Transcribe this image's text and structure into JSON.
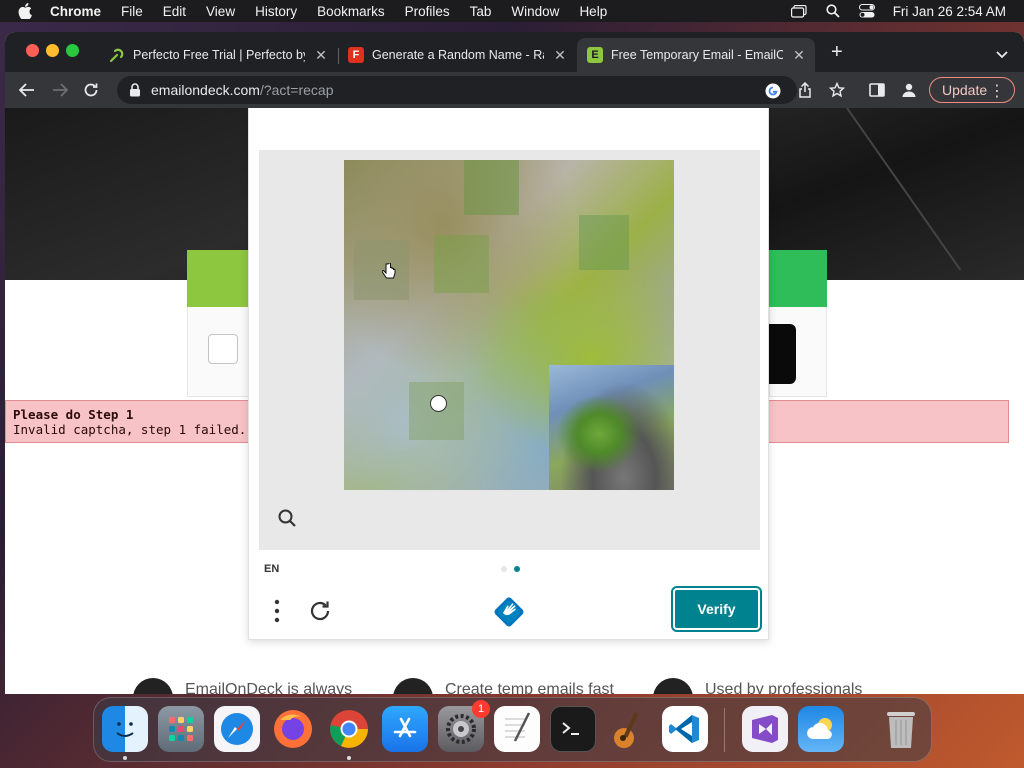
{
  "menubar": {
    "items": [
      "Chrome",
      "File",
      "Edit",
      "View",
      "History",
      "Bookmarks",
      "Profiles",
      "Tab",
      "Window",
      "Help"
    ],
    "datetime": "Fri Jan 26  2:54 AM"
  },
  "browser": {
    "tabs": [
      {
        "title": "Perfecto Free Trial | Perfecto by",
        "favicon": "perfecto-icon",
        "color": "#8dc63f"
      },
      {
        "title": "Generate a Random Name - Ra",
        "favicon": "F",
        "color": "#e0301e"
      },
      {
        "title": "Free Temporary Email - EmailO",
        "favicon": "E",
        "color": "#8dc63f"
      }
    ],
    "url_host": "emailondeck.com",
    "url_path": "/?act=recap",
    "update_label": "Update"
  },
  "page": {
    "error_title": "Please do Step 1",
    "error_message": "Invalid captcha, step 1 failed.",
    "features": [
      {
        "text": "EmailOnDeck is always",
        "icon": "free-badge-icon"
      },
      {
        "text": "Create temp emails fast",
        "icon": "send-icon"
      },
      {
        "text": "Used by professionals",
        "icon": "globe-icon"
      }
    ]
  },
  "captcha": {
    "language": "EN",
    "verify_label": "Verify",
    "pages": 2,
    "current_page": 2,
    "accent": "#00838f"
  },
  "dock": {
    "apps": [
      "Finder",
      "Launchpad",
      "Safari",
      "Firefox",
      "Chrome",
      "App Store",
      "System Settings",
      "TextEdit",
      "Terminal",
      "GarageBand",
      "Visual Studio Code",
      "Visual Studio",
      "Weather",
      "Trash"
    ],
    "settings_badge": "1"
  }
}
